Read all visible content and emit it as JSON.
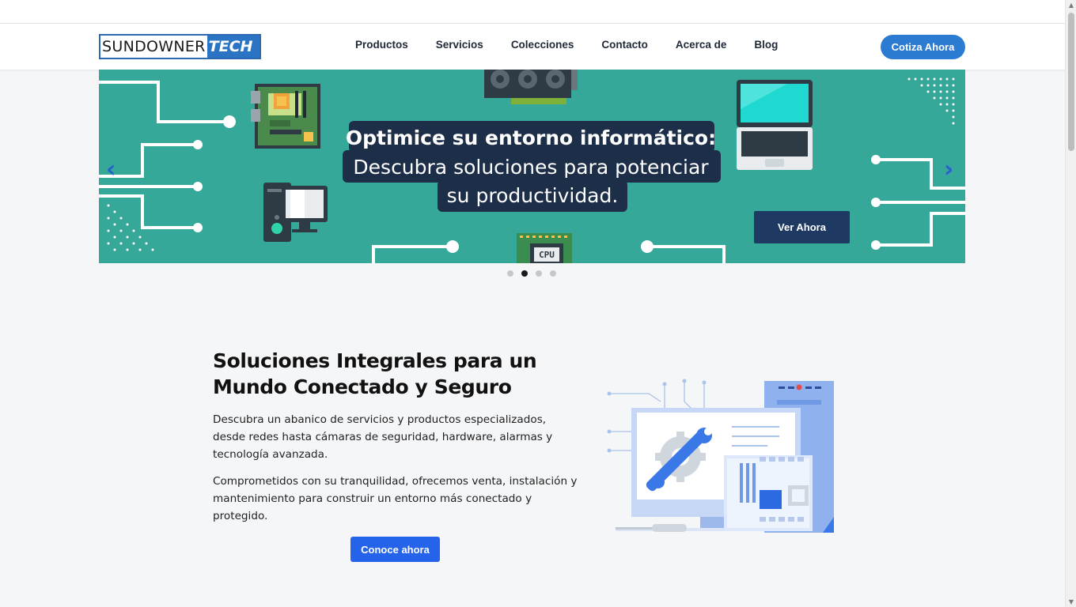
{
  "header": {
    "logo_part1": "SUNDOWNER",
    "logo_part2": "TECH",
    "nav": [
      "Productos",
      "Servicios",
      "Colecciones",
      "Contacto",
      "Acerca de",
      "Blog"
    ],
    "cta_label": "Cotiza Ahora"
  },
  "hero": {
    "title_line1": "Optimice su entorno informático:",
    "title_line2": "Descubra soluciones para potenciar",
    "title_line3": "su productividad.",
    "button_label": "Ver Ahora",
    "chip_label": "CPU",
    "prev_arrow": "‹",
    "next_arrow": "›",
    "active_slide": 2,
    "slide_count": 4
  },
  "intro": {
    "title": "Soluciones Integrales para un Mundo Conectado y Seguro",
    "paragraph1": "Descubra un abanico de servicios y productos especializados, desde redes hasta cámaras de seguridad, hardware, alarmas y tecnología avanzada.",
    "paragraph2": "Comprometidos con su tranquilidad, ofrecemos venta, instalación y mantenimiento para construir un entorno más conectado y protegido.",
    "button_label": "Conoce ahora"
  },
  "colors": {
    "accent": "#2b7bd3",
    "hero_bg": "#36a89a",
    "dark_navy": "#1f3a62",
    "button_blue": "#2563eb"
  }
}
